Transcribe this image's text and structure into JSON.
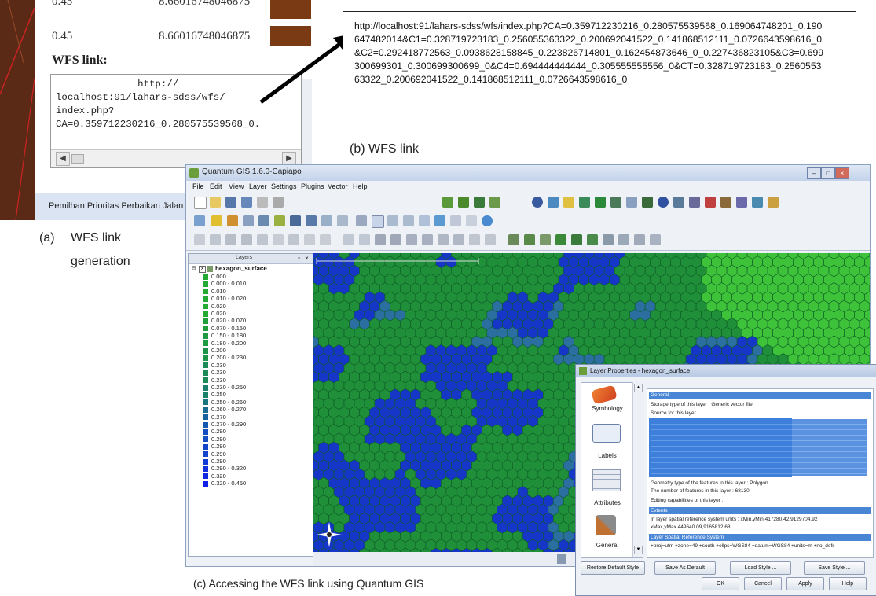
{
  "panel_a": {
    "top_partial_value": "0.45",
    "top_partial_number": "8.66016748046875",
    "row_value": "0.45",
    "row_number": "8.66016748046875",
    "wfs_label": "WFS link:",
    "textarea_lines": [
      "              http://",
      "localhost:91/lahars-sdss/wfs/",
      "index.php?",
      "CA=0.359712230216_0.280575539568_0."
    ],
    "scroll_left": "◀",
    "scroll_right": "▶",
    "bar_text": "Pemilhan Prioritas Perbaikan Jalan",
    "caption_letter": "(a)",
    "caption_line1": "WFS link",
    "caption_line2": "generation"
  },
  "panel_b": {
    "url": "http://localhost:91/lahars-sdss/wfs/index.php?CA=0.359712230216_0.280575539568_0.169064748201_0.190647482014&C1=0.328719723183_0.256055363322_0.200692041522_0.141868512111_0.0726643598616_0&C2=0.292418772563_0.0938628158845_0.223826714801_0.162454873646_0_0.227436823105&C3=0.699300699301_0.300699300699_0&C4=0.694444444444_0.305555555556_0&CT=0.328719723183_0.256055363322_0.200692041522_0.141868512111_0.0726643598616_0",
    "caption": "(b)   WFS link"
  },
  "panel_c": {
    "window_title": "Quantum GIS 1.6.0-Capiapo",
    "menu": [
      "File",
      "Edit",
      "View",
      "Layer",
      "Settings",
      "Plugins",
      "Vector",
      "Help"
    ],
    "layers_header": "Layers",
    "layer_name": "hexagon_surface",
    "legend": [
      {
        "label": "0.000",
        "color": "#22aa33"
      },
      {
        "label": "0.000 - 0.010",
        "color": "#22aa33"
      },
      {
        "label": "0.010",
        "color": "#22aa33"
      },
      {
        "label": "0.010 - 0.020",
        "color": "#22aa33"
      },
      {
        "label": "0.020",
        "color": "#22aa33"
      },
      {
        "label": "0.020",
        "color": "#22aa33"
      },
      {
        "label": "0.020 - 0.070",
        "color": "#1f9e3a"
      },
      {
        "label": "0.070 - 0.150",
        "color": "#1f9e3a"
      },
      {
        "label": "0.150 - 0.180",
        "color": "#1e9a40"
      },
      {
        "label": "0.180 - 0.200",
        "color": "#1e9a40"
      },
      {
        "label": "0.200",
        "color": "#1c9448"
      },
      {
        "label": "0.200 - 0.230",
        "color": "#1c9448"
      },
      {
        "label": "0.230",
        "color": "#1a8a56"
      },
      {
        "label": "0.230",
        "color": "#1a8a56"
      },
      {
        "label": "0.230",
        "color": "#1a8a56"
      },
      {
        "label": "0.230 - 0.250",
        "color": "#19806a"
      },
      {
        "label": "0.250",
        "color": "#19806a"
      },
      {
        "label": "0.250 - 0.260",
        "color": "#18767e"
      },
      {
        "label": "0.260 - 0.270",
        "color": "#176c90"
      },
      {
        "label": "0.270",
        "color": "#1662a0"
      },
      {
        "label": "0.270 - 0.290",
        "color": "#1558b0"
      },
      {
        "label": "0.290",
        "color": "#144ec0"
      },
      {
        "label": "0.290",
        "color": "#144ec0"
      },
      {
        "label": "0.290",
        "color": "#1344cc"
      },
      {
        "label": "0.290",
        "color": "#1344cc"
      },
      {
        "label": "0.290",
        "color": "#123ad6"
      },
      {
        "label": "0.290 - 0.320",
        "color": "#1230dc"
      },
      {
        "label": "0.320",
        "color": "#1128e2"
      },
      {
        "label": "0.320 - 0.450",
        "color": "#1020e8"
      }
    ],
    "caption": "(c)   Accessing the WFS link using Quantum GIS",
    "map_colors": {
      "green": "#1f8f3a",
      "blue": "#1636c8",
      "teal": "#2a6fa0",
      "light_green": "#3ec23a"
    }
  },
  "layer_props": {
    "title": "Layer Properties - hexagon_surface",
    "side_items": [
      "Symbology",
      "Labels",
      "Attributes",
      "General"
    ],
    "section_general": "General",
    "storage_text": "Storage type of this layer : Generic vector file",
    "source_text": "Source for this layer :",
    "geometry_text": "Geometry type of the features in this layer : Polygon",
    "features_text": "The number of features in this layer : 68130",
    "editing_text": "Editing capabilities of this layer :",
    "section_extents": "Extents",
    "extent_line1": "In layer spatial reference system units : xMin,yMin 417280.42,9129704.92",
    "extent_line2": "xMax,yMax 449640.09,9165812.68",
    "section_srs": "Layer Spatial Reference System",
    "srs_text": "+proj=utm +zone=49 +south +ellps=WGS84 +datum=WGS84 +units=m +no_defs",
    "buttons_row1": [
      "Restore Default Style",
      "Save As Default",
      "Load Style ...",
      "Save Style ..."
    ],
    "buttons_row2": [
      "OK",
      "Cancel",
      "Apply",
      "Help"
    ]
  }
}
